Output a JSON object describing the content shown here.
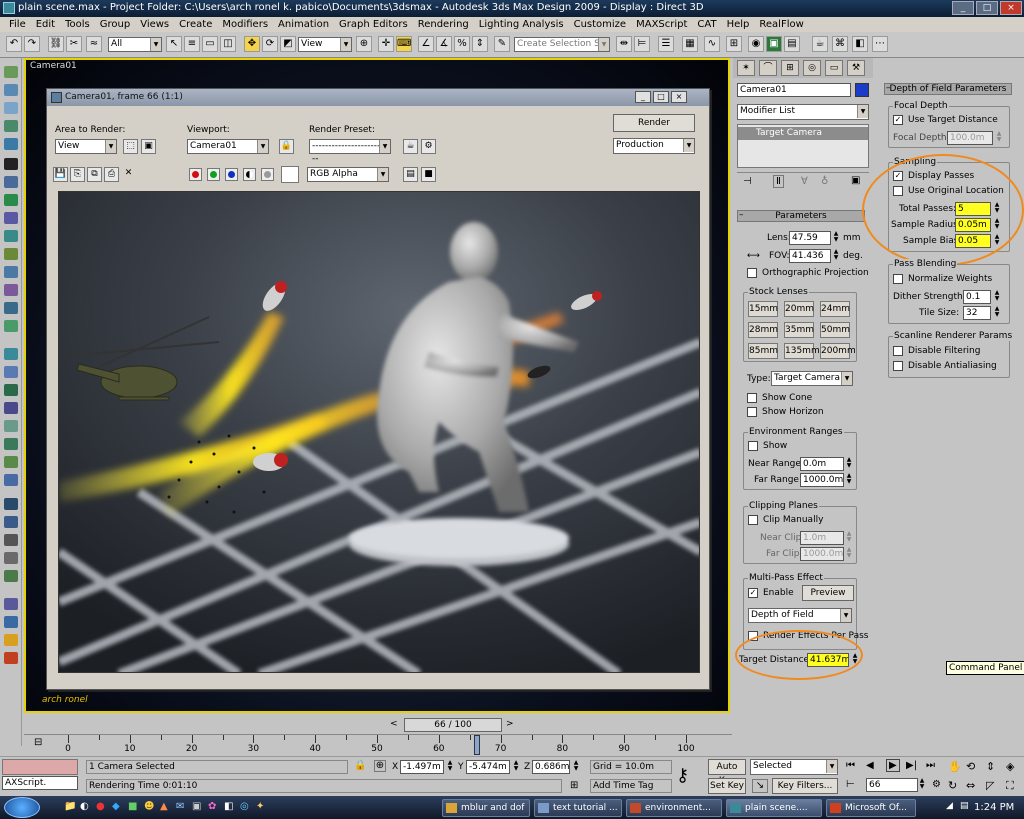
{
  "window": {
    "title": "plain scene.max    - Project Folder: C:\\Users\\arch ronel k. pabico\\Documents\\3dsmax    - Autodesk 3ds Max Design 2009     - Display : Direct 3D"
  },
  "menu": [
    "File",
    "Edit",
    "Tools",
    "Group",
    "Views",
    "Create",
    "Modifiers",
    "Animation",
    "Graph Editors",
    "Rendering",
    "Lighting Analysis",
    "Customize",
    "MAXScript",
    "CAT",
    "Help",
    "RealFlow"
  ],
  "toolbar": {
    "selection_filter": "All",
    "ref_coord": "View",
    "named_selection_placeholder": "Create Selection Set"
  },
  "viewport": {
    "label": "Camera01",
    "credit": "arch ronel"
  },
  "render_window": {
    "title": "Camera01, frame 66 (1:1)",
    "area_label": "Area to Render:",
    "area_value": "View",
    "viewport_label": "Viewport:",
    "viewport_value": "Camera01",
    "preset_label": "Render Preset:",
    "preset_value": "--------------------------",
    "render_button": "Render",
    "production_value": "Production",
    "channel_value": "RGB Alpha"
  },
  "command_panel": {
    "object_name": "Camera01",
    "modifier_list": "Modifier List",
    "stack_item": "Target Camera",
    "params_header": "Parameters",
    "lens_label": "Lens:",
    "lens_value": "47.59",
    "lens_unit": "mm",
    "fov_label": "FOV:",
    "fov_value": "41.436",
    "fov_unit": "deg.",
    "ortho": "Orthographic Projection",
    "stock_lenses_label": "Stock Lenses",
    "stock_lenses": [
      "15mm",
      "20mm",
      "24mm",
      "28mm",
      "35mm",
      "50mm",
      "85mm",
      "135mm",
      "200mm"
    ],
    "type_label": "Type:",
    "type_value": "Target Camera",
    "show_cone": "Show Cone",
    "show_horizon": "Show Horizon",
    "env_ranges": "Environment Ranges",
    "env_show": "Show",
    "near_range_label": "Near Range:",
    "near_range_value": "0.0m",
    "far_range_label": "Far Range:",
    "far_range_value": "1000.0m",
    "clipping_planes": "Clipping Planes",
    "clip_manually": "Clip Manually",
    "near_clip_label": "Near Clip:",
    "near_clip_value": "1.0m",
    "far_clip_label": "Far Clip:",
    "far_clip_value": "1000.0m",
    "multipass": "Multi-Pass Effect",
    "enable": "Enable",
    "preview": "Preview",
    "effect_value": "Depth of Field",
    "render_effects_per_pass": "Render Effects Per Pass",
    "target_distance_label": "Target Distance:",
    "target_distance_value": "41.637m"
  },
  "dof_panel": {
    "header": "Depth of Field Parameters",
    "focal_depth": "Focal Depth",
    "use_target_distance": "Use Target Distance",
    "focal_depth_label": "Focal Depth:",
    "focal_depth_value": "100.0m",
    "sampling": "Sampling",
    "display_passes": "Display Passes",
    "use_original_location": "Use Original Location",
    "total_passes_label": "Total Passes:",
    "total_passes_value": "5",
    "sample_radius_label": "Sample Radius:",
    "sample_radius_value": "0.05m",
    "sample_bias_label": "Sample Bias:",
    "sample_bias_value": "0.05",
    "pass_blending": "Pass Blending",
    "normalize_weights": "Normalize Weights",
    "dither_label": "Dither Strength:",
    "dither_value": "0.1",
    "tile_label": "Tile Size:",
    "tile_value": "32",
    "scanline": "Scanline Renderer Params",
    "disable_filtering": "Disable Filtering",
    "disable_antialiasing": "Disable Antialiasing",
    "tooltip": "Command Panel"
  },
  "timeline": {
    "slider_label": "66 / 100",
    "ticks": [
      "0",
      "10",
      "20",
      "30",
      "40",
      "50",
      "60",
      "70",
      "80",
      "90",
      "100"
    ]
  },
  "status": {
    "maxscript": "AXScript.",
    "selection": "1 Camera Selected",
    "rendering_time": "Rendering Time  0:01:10",
    "x": "-1.497m",
    "y": "-5.474m",
    "z": "0.686m",
    "grid": "Grid = 10.0m",
    "add_time_tag": "Add Time Tag",
    "auto_key": "Auto Key",
    "selected": "Selected",
    "set_key": "Set Key",
    "key_filters": "Key Filters...",
    "frame": "66"
  },
  "taskbar": {
    "items": [
      "mblur and dof",
      "text tutorial ...",
      "environment...",
      "plain scene....",
      "Microsoft Of..."
    ],
    "clock": "1:24 PM"
  }
}
